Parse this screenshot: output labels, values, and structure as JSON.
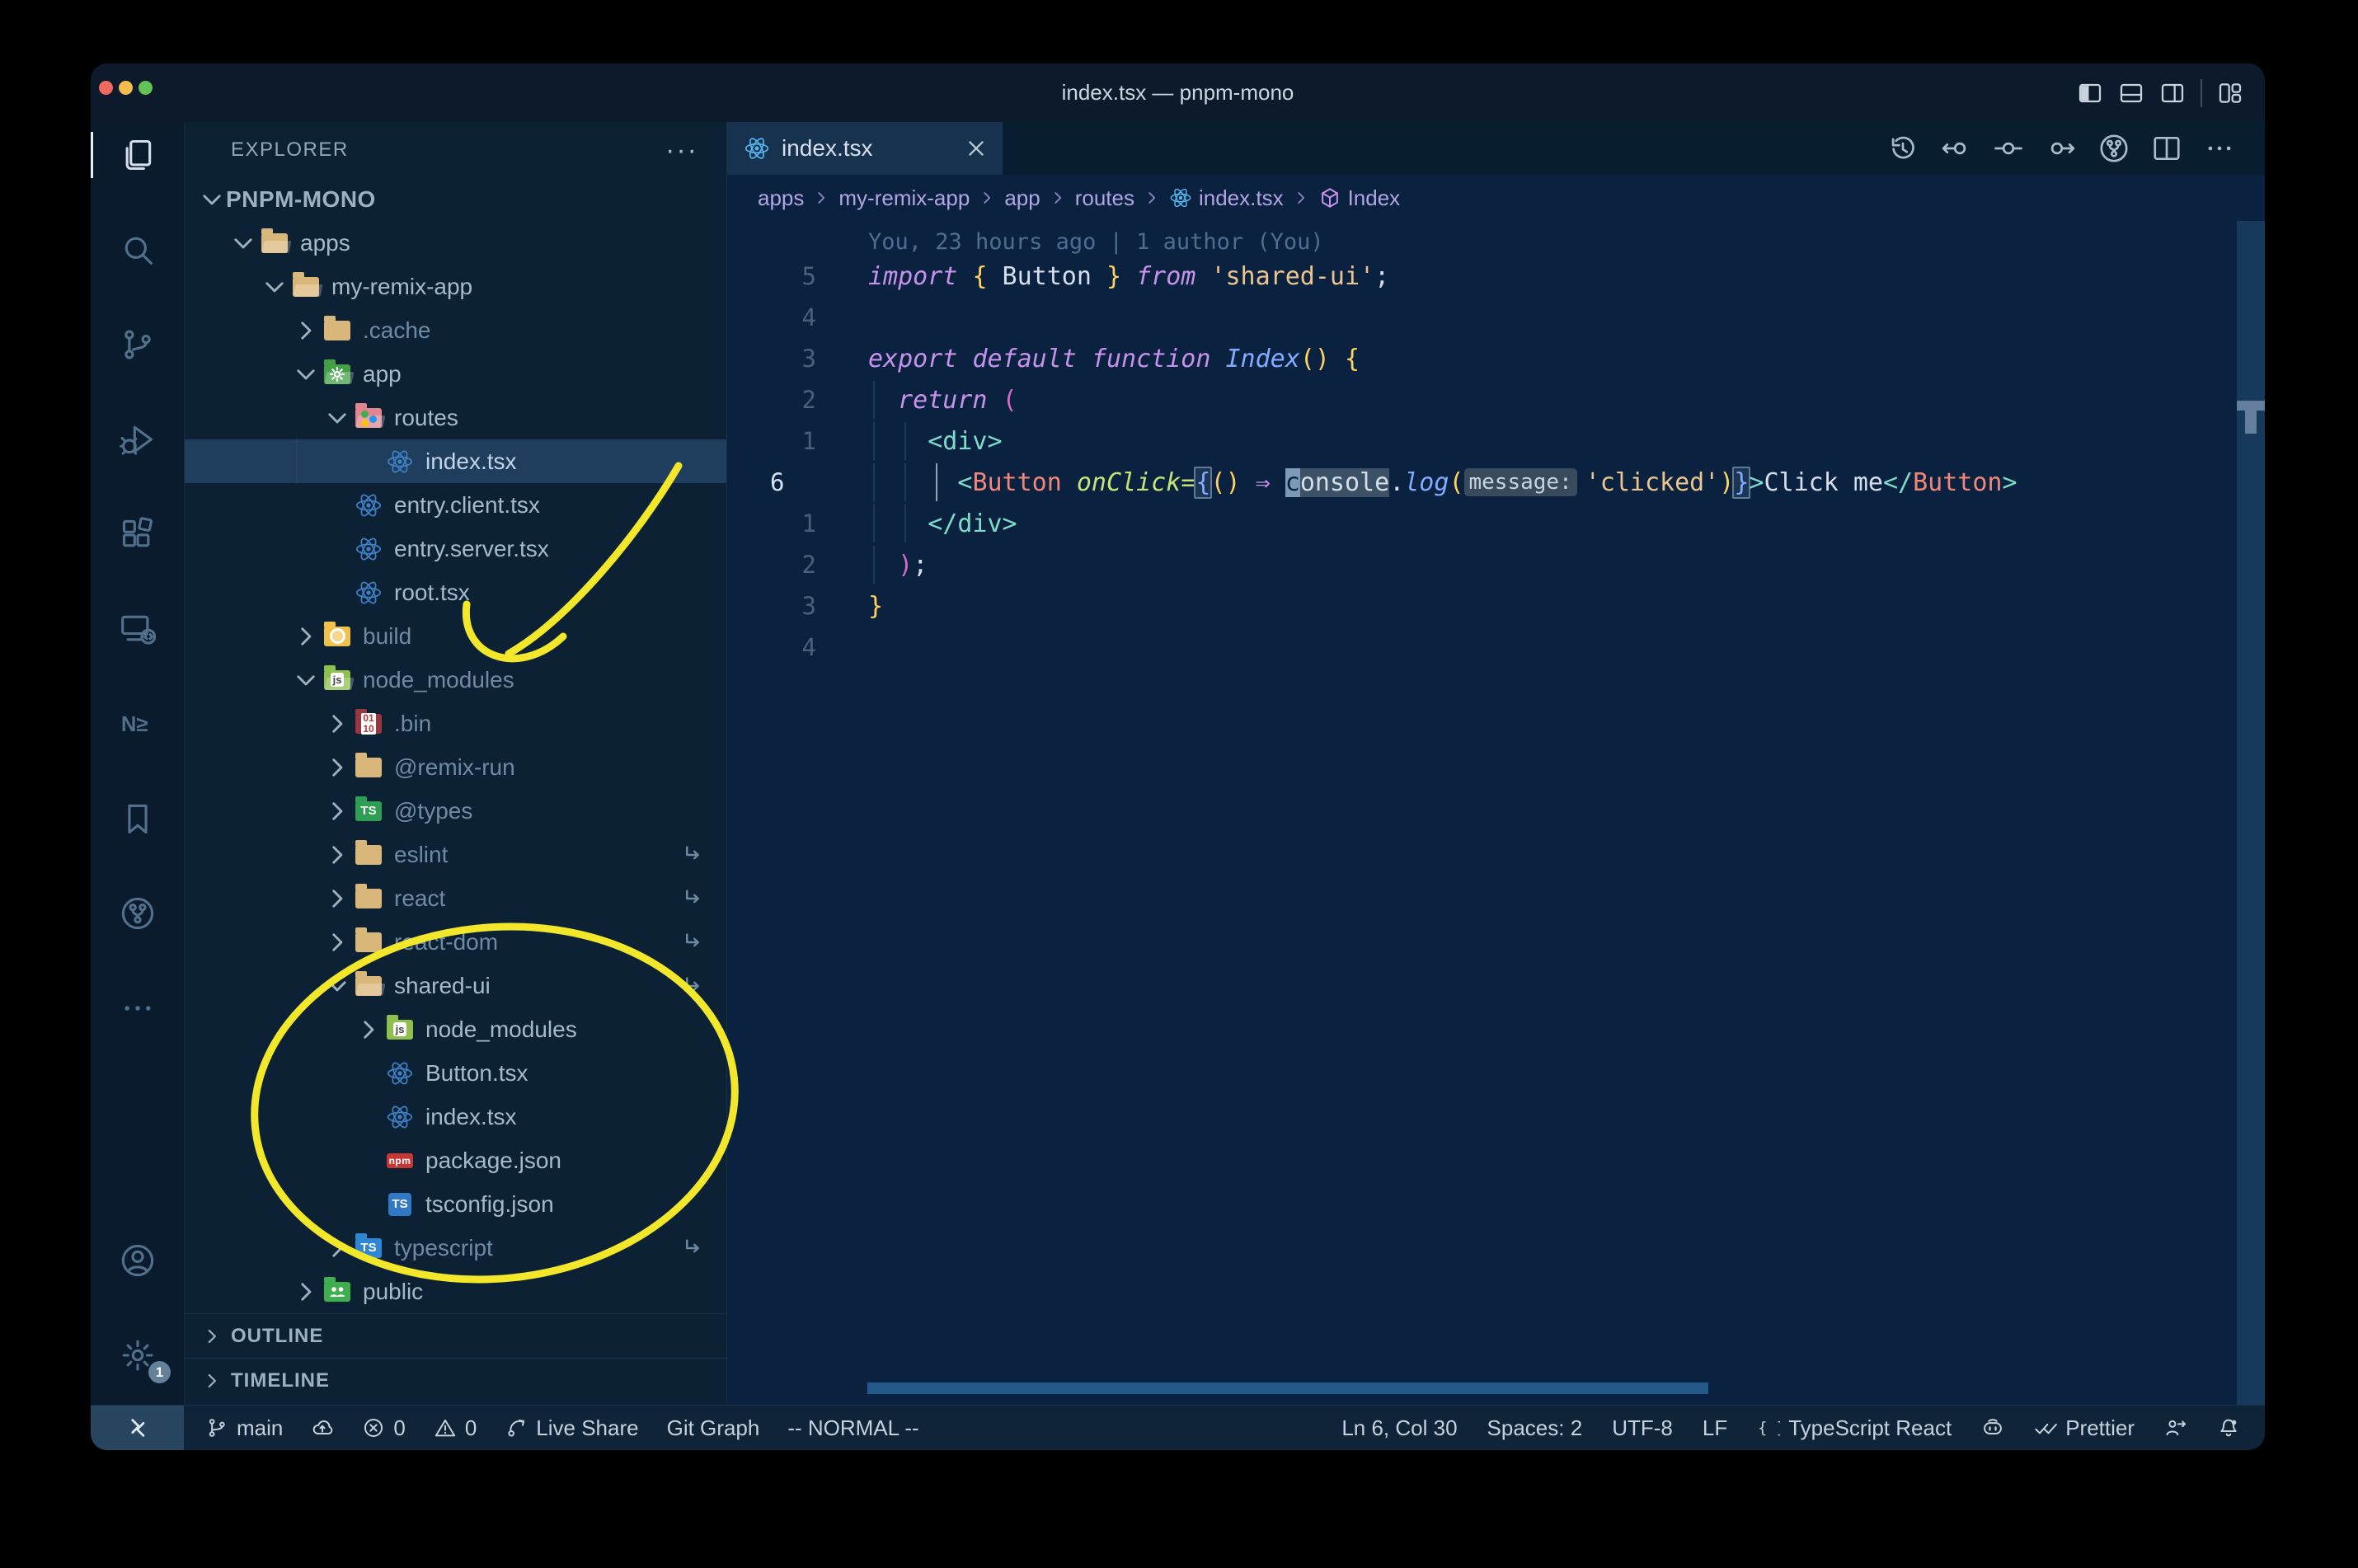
{
  "colors": {
    "annotation_yellow": "#f2e72b",
    "editor_bg": "#0a2240",
    "sidebar_bg": "#0c2134",
    "statusbar_bg": "#0f2438",
    "selection_row": "#1f3d5c",
    "accent_purple": "#c792ea",
    "accent_teal": "#7fdbca",
    "accent_gold": "#ffd35f"
  },
  "window": {
    "title": "index.tsx — pnpm-mono",
    "controls": [
      "layout-left",
      "layout-bottom",
      "layout-right",
      "layout-grid"
    ]
  },
  "activity_bar": {
    "items": [
      {
        "icon": "files",
        "name": "explorer",
        "active": true
      },
      {
        "icon": "search",
        "name": "search"
      },
      {
        "icon": "source-control",
        "name": "source-control"
      },
      {
        "icon": "debug",
        "name": "run-and-debug"
      },
      {
        "icon": "extensions",
        "name": "extensions"
      },
      {
        "icon": "remote",
        "name": "remote-explorer"
      },
      {
        "icon": "nx",
        "name": "nx-console"
      },
      {
        "icon": "bookmarks",
        "name": "bookmarks"
      },
      {
        "icon": "git-graph",
        "name": "git-graph"
      },
      {
        "icon": "more",
        "name": "additional-views"
      }
    ],
    "bottom": [
      {
        "icon": "account",
        "name": "accounts"
      },
      {
        "icon": "gear",
        "name": "settings",
        "badge": "1"
      }
    ]
  },
  "explorer": {
    "title": "EXPLORER",
    "actions": "···",
    "outline": "OUTLINE",
    "timeline": "TIMELINE",
    "tree": [
      {
        "label": "PNPM-MONO",
        "level": 0,
        "expand": "open",
        "root": true
      },
      {
        "label": "apps",
        "level": 1,
        "expand": "open",
        "icon": "folder-tan",
        "open": true
      },
      {
        "label": "my-remix-app",
        "level": 2,
        "expand": "open",
        "icon": "folder-tan",
        "open": true
      },
      {
        "label": ".cache",
        "level": 3,
        "expand": "closed",
        "icon": "folder-tan",
        "dim": true
      },
      {
        "label": "app",
        "level": 3,
        "expand": "open",
        "icon": "folder-app",
        "open": true
      },
      {
        "label": "routes",
        "level": 4,
        "expand": "open",
        "icon": "folder-routes",
        "open": true
      },
      {
        "label": "index.tsx",
        "level": 5,
        "icon": "react",
        "selected": true
      },
      {
        "label": "entry.client.tsx",
        "level": 4,
        "icon": "react"
      },
      {
        "label": "entry.server.tsx",
        "level": 4,
        "icon": "react"
      },
      {
        "label": "root.tsx",
        "level": 4,
        "icon": "react"
      },
      {
        "label": "build",
        "level": 3,
        "expand": "closed",
        "icon": "folder-build",
        "dim": true
      },
      {
        "label": "node_modules",
        "level": 3,
        "expand": "open",
        "icon": "folder-nm",
        "open": true,
        "dim": true
      },
      {
        "label": ".bin",
        "level": 4,
        "expand": "closed",
        "icon": "folder-bin",
        "dim": true
      },
      {
        "label": "@remix-run",
        "level": 4,
        "expand": "closed",
        "icon": "folder-tan",
        "dim": true
      },
      {
        "label": "@types",
        "level": 4,
        "expand": "closed",
        "icon": "folder-types",
        "dim": true
      },
      {
        "label": "eslint",
        "level": 4,
        "expand": "closed",
        "icon": "folder-tan",
        "dim": true,
        "symlink": true
      },
      {
        "label": "react",
        "level": 4,
        "expand": "closed",
        "icon": "folder-tan",
        "dim": true,
        "symlink": true
      },
      {
        "label": "react-dom",
        "level": 4,
        "expand": "closed",
        "icon": "folder-tan",
        "dim": true,
        "symlink": true
      },
      {
        "label": "shared-ui",
        "level": 4,
        "expand": "open",
        "icon": "folder-tan",
        "open": true,
        "symlink": true
      },
      {
        "label": "node_modules",
        "level": 5,
        "expand": "closed",
        "icon": "folder-nm"
      },
      {
        "label": "Button.tsx",
        "level": 5,
        "icon": "react"
      },
      {
        "label": "index.tsx",
        "level": 5,
        "icon": "react"
      },
      {
        "label": "package.json",
        "level": 5,
        "icon": "npm"
      },
      {
        "label": "tsconfig.json",
        "level": 5,
        "icon": "tsconfig"
      },
      {
        "label": "typescript",
        "level": 4,
        "expand": "closed",
        "icon": "folder-tsb",
        "dim": true,
        "symlink": true
      },
      {
        "label": "public",
        "level": 3,
        "expand": "closed",
        "icon": "folder-public"
      }
    ]
  },
  "tabs": [
    {
      "label": "index.tsx",
      "icon": "react",
      "active": true
    }
  ],
  "editor_actions": [
    "history",
    "nav-back",
    "nav-dot",
    "nav-fwd",
    "git-graph",
    "split",
    "more"
  ],
  "breadcrumbs": [
    {
      "label": "apps"
    },
    {
      "label": "my-remix-app"
    },
    {
      "label": "app"
    },
    {
      "label": "routes"
    },
    {
      "label": "index.tsx",
      "icon": "react"
    },
    {
      "label": "Index",
      "icon": "cube"
    }
  ],
  "editor": {
    "blame": "You, 23 hours ago | 1 author (You)",
    "lines": [
      {
        "num": "5",
        "tokens": [
          [
            "k",
            "import"
          ],
          [
            "p",
            " "
          ],
          [
            "g",
            "{"
          ],
          [
            "p",
            " Button "
          ],
          [
            "g",
            "}"
          ],
          [
            "p",
            " "
          ],
          [
            "k",
            "from"
          ],
          [
            "p",
            " "
          ],
          [
            "s",
            "'shared-ui'"
          ],
          [
            "p",
            ";"
          ]
        ]
      },
      {
        "num": "4",
        "tokens": []
      },
      {
        "num": "3",
        "tokens": [
          [
            "k",
            "export"
          ],
          [
            "p",
            " "
          ],
          [
            "k",
            "default"
          ],
          [
            "p",
            " "
          ],
          [
            "k",
            "function"
          ],
          [
            "p",
            " "
          ],
          [
            "f",
            "Index"
          ],
          [
            "g",
            "()"
          ],
          [
            "p",
            " "
          ],
          [
            "g",
            "{"
          ]
        ]
      },
      {
        "num": "2",
        "tokens": [
          [
            "p",
            "  "
          ],
          [
            "k",
            "return"
          ],
          [
            "p",
            " "
          ],
          [
            "pk",
            "("
          ]
        ]
      },
      {
        "num": "1",
        "tokens": [
          [
            "p",
            "    "
          ],
          [
            "t",
            "<div>"
          ]
        ]
      },
      {
        "num": "6",
        "current": true,
        "tokens": [
          [
            "p",
            "      "
          ],
          [
            "t",
            "<"
          ],
          [
            "c",
            "Button"
          ],
          [
            "p",
            " "
          ],
          [
            "a",
            "onClick"
          ],
          [
            "a",
            "="
          ],
          [
            "bx",
            "{"
          ],
          [
            "g",
            "()"
          ],
          [
            "p",
            " "
          ],
          [
            "o",
            "⇒"
          ],
          [
            "p",
            " "
          ],
          [
            "cu",
            "c"
          ],
          [
            "hl",
            "onsole"
          ],
          [
            "p",
            "."
          ],
          [
            "f",
            "log"
          ],
          [
            "g",
            "("
          ],
          [
            "in",
            "message:"
          ],
          [
            "s",
            "'clicked'"
          ],
          [
            "g",
            ")"
          ],
          [
            "bx",
            "}"
          ],
          [
            "t",
            ">"
          ],
          [
            "p",
            "Click me"
          ],
          [
            "t",
            "</"
          ],
          [
            "c",
            "Button"
          ],
          [
            "t",
            ">"
          ]
        ]
      },
      {
        "num": "1",
        "tokens": [
          [
            "p",
            "    "
          ],
          [
            "t",
            "</div>"
          ]
        ]
      },
      {
        "num": "2",
        "tokens": [
          [
            "p",
            "  "
          ],
          [
            "pk",
            ")"
          ],
          [
            "p",
            ";"
          ]
        ]
      },
      {
        "num": "3",
        "tokens": [
          [
            "g",
            "}"
          ]
        ]
      },
      {
        "num": "4",
        "tokens": []
      }
    ]
  },
  "status_bar": {
    "remote": "><",
    "left": [
      {
        "icon": "branch",
        "label": "main",
        "name": "git-branch"
      },
      {
        "icon": "cloud-up",
        "label": "",
        "name": "sync-changes"
      },
      {
        "icon": "error",
        "label": "0",
        "name": "errors"
      },
      {
        "icon": "warning",
        "label": "0",
        "name": "warnings"
      },
      {
        "icon": "liveshare",
        "label": "Live Share",
        "name": "live-share"
      },
      {
        "icon": "",
        "label": "Git Graph",
        "name": "git-graph"
      },
      {
        "icon": "",
        "label": "-- NORMAL --",
        "name": "vim-mode"
      }
    ],
    "right": [
      {
        "icon": "",
        "label": "Ln 6, Col 30",
        "name": "cursor-position"
      },
      {
        "icon": "",
        "label": "Spaces: 2",
        "name": "indentation"
      },
      {
        "icon": "",
        "label": "UTF-8",
        "name": "encoding"
      },
      {
        "icon": "",
        "label": "LF",
        "name": "eol"
      },
      {
        "icon": "braces",
        "label": "TypeScript React",
        "name": "language-mode"
      },
      {
        "icon": "copilot",
        "label": "",
        "name": "copilot"
      },
      {
        "icon": "double-check",
        "label": "Prettier",
        "name": "prettier"
      },
      {
        "icon": "feedback",
        "label": "",
        "name": "feedback"
      },
      {
        "icon": "bell",
        "label": "",
        "name": "notifications"
      }
    ]
  },
  "annotations": {
    "color": "#f2e72b"
  }
}
